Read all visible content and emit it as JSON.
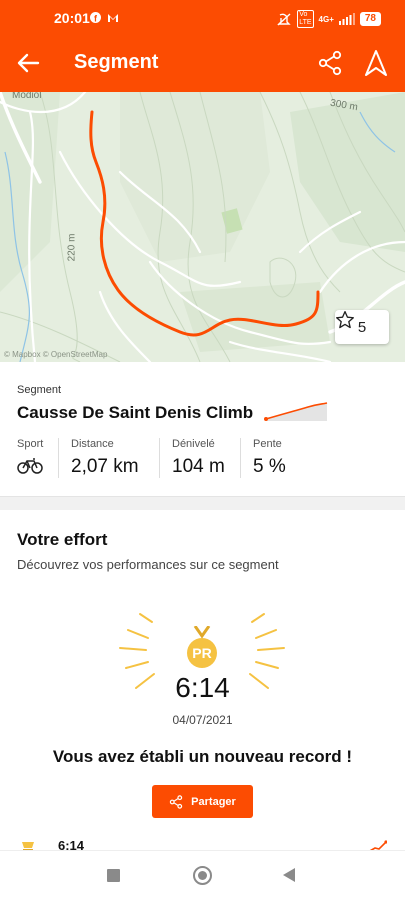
{
  "status_bar": {
    "time": "20:01",
    "battery": "78",
    "network": "4G+",
    "icons": [
      "facebook-icon",
      "gmail-icon",
      "mute-icon",
      "volte-icon",
      "signal-icon",
      "battery-icon"
    ]
  },
  "app_bar": {
    "title": "Segment",
    "icons": [
      "back-arrow-icon",
      "share-icon",
      "navigate-icon"
    ],
    "accent_color": "#fc4c02"
  },
  "map": {
    "labels": [
      "Modiol",
      "300 m",
      "220 m"
    ],
    "attribution": "© Mapbox © OpenStreetMap",
    "star_count": "5",
    "route_color": "#fc4c02"
  },
  "segment": {
    "kicker": "Segment",
    "name": "Causse De Saint Denis Climb",
    "stats": [
      {
        "label": "Sport",
        "icon": "bike-icon"
      },
      {
        "label": "Distance",
        "value": "2,07 km"
      },
      {
        "label": "Dénivelé",
        "value": "104 m"
      },
      {
        "label": "Pente",
        "value": "5 %"
      }
    ]
  },
  "effort": {
    "heading": "Votre effort",
    "subtitle": "Découvrez vos performances sur ce segment",
    "medal_text": "PR",
    "time": "6:14",
    "date": "04/07/2021",
    "record_message": "Vous avez établi un nouveau record !",
    "share_button": "Partager",
    "row_time": "6:14",
    "medal_color": "#f5c242",
    "burst_color": "#f5c242"
  }
}
